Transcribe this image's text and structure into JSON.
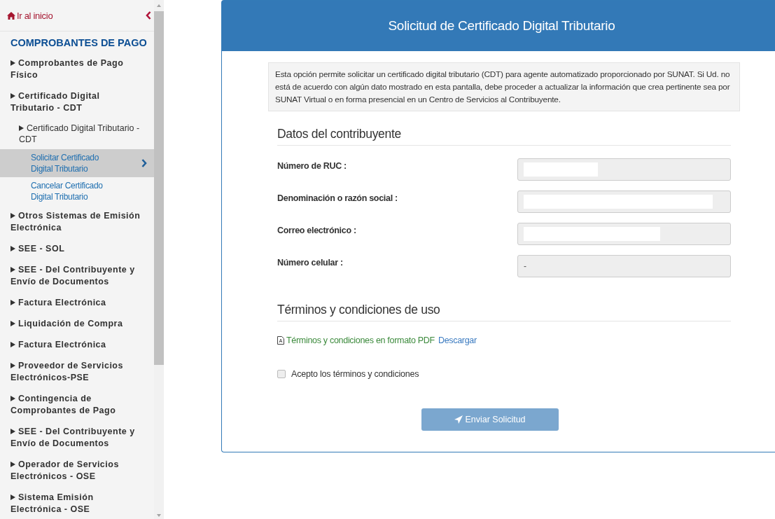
{
  "sidebar": {
    "home_link": "Ir al inicio",
    "section_title": "COMPROBANTES DE PAGO",
    "items": [
      {
        "label": "Comprobantes de Pago Físico"
      },
      {
        "label": "Certificado Digital Tributario - CDT",
        "children": [
          {
            "label": "Certificado Digital Tributario - CDT",
            "children": [
              {
                "label": "Solicitar Certificado Digital Tributario",
                "selected": true
              },
              {
                "label": "Cancelar Certificado Digital Tributario",
                "selected": false
              }
            ]
          }
        ]
      },
      {
        "label": "Otros Sistemas de Emisión Electrónica"
      },
      {
        "label": "SEE - SOL"
      },
      {
        "label": "SEE - Del Contribuyente y Envío de Documentos"
      },
      {
        "label": "Factura Electrónica"
      },
      {
        "label": "Liquidación de Compra"
      },
      {
        "label": "Factura Electrónica"
      },
      {
        "label": "Proveedor de Servicios Electrónicos-PSE"
      },
      {
        "label": "Contingencia de Comprobantes de Pago"
      },
      {
        "label": "SEE - Del Contribuyente y Envío de Documentos"
      },
      {
        "label": "Operador de Servicios Electrónicos - OSE"
      },
      {
        "label": "Sistema Emisión Electrónica - OSE"
      }
    ]
  },
  "panel": {
    "title": "Solicitud de Certificado Digital Tributario",
    "notice": "Esta opción permite solicitar un certificado digital tributario (CDT) para agente automatizado proporcionado por SUNAT. Si Ud. no está de acuerdo con algún dato mostrado en esta pantalla, debe proceder a actualizar la información que crea pertinente sea por SUNAT Virtual o en forma presencial en un Centro de Servicios al Contribuyente.",
    "data_heading": "Datos del contribuyente",
    "fields": [
      {
        "label": "Número de RUC :",
        "redacted": true
      },
      {
        "label": "Denominación o razón social :",
        "redacted": true
      },
      {
        "label": "Correo electrónico :",
        "redacted": true
      },
      {
        "label": "Número celular :",
        "redacted": false,
        "value": "-"
      }
    ],
    "terms_heading": "Términos y condiciones de uso",
    "terms_text": "Términos y condiciones en formato PDF",
    "terms_link": "Descargar",
    "accept": {
      "label": "Acepto los términos y condiciones",
      "checked": false
    },
    "submit": {
      "label": "Enviar Solicitud",
      "disabled": true
    }
  }
}
